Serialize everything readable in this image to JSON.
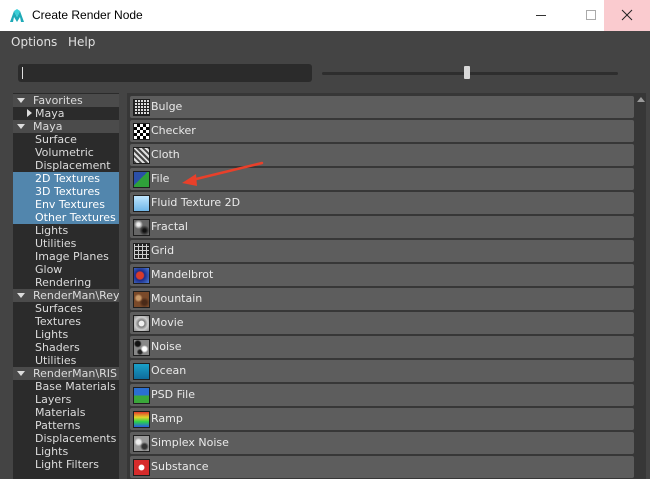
{
  "window": {
    "title": "Create Render Node",
    "icon": "maya-icon",
    "controls": [
      "minimize-icon",
      "maximize-icon",
      "close-icon"
    ]
  },
  "menu": {
    "items": [
      "Options",
      "Help"
    ]
  },
  "search": {
    "value": "",
    "placeholder": ""
  },
  "icon_size_slider": {
    "value_fraction": 0.49
  },
  "tree": [
    {
      "label": "Favorites",
      "type": "header",
      "expanded": true
    },
    {
      "label": "Maya",
      "type": "subheader",
      "expanded": false
    },
    {
      "label": "Maya",
      "type": "header",
      "expanded": true
    },
    {
      "label": "Surface",
      "type": "item"
    },
    {
      "label": "Volumetric",
      "type": "item"
    },
    {
      "label": "Displacement",
      "type": "item"
    },
    {
      "label": "2D Textures",
      "type": "item",
      "selected": true
    },
    {
      "label": "3D Textures",
      "type": "item",
      "selected": true
    },
    {
      "label": "Env Textures",
      "type": "item",
      "selected": true
    },
    {
      "label": "Other Textures",
      "type": "item",
      "selected": true
    },
    {
      "label": "Lights",
      "type": "item"
    },
    {
      "label": "Utilities",
      "type": "item"
    },
    {
      "label": "Image Planes",
      "type": "item"
    },
    {
      "label": "Glow",
      "type": "item"
    },
    {
      "label": "Rendering",
      "type": "item"
    },
    {
      "label": "RenderMan\\Reyes",
      "type": "header",
      "expanded": true
    },
    {
      "label": "Surfaces",
      "type": "item"
    },
    {
      "label": "Textures",
      "type": "item"
    },
    {
      "label": "Lights",
      "type": "item"
    },
    {
      "label": "Shaders",
      "type": "item"
    },
    {
      "label": "Utilities",
      "type": "item"
    },
    {
      "label": "RenderMan\\RIS",
      "type": "header",
      "expanded": true
    },
    {
      "label": "Base Materials",
      "type": "item"
    },
    {
      "label": "Layers",
      "type": "item"
    },
    {
      "label": "Materials",
      "type": "item"
    },
    {
      "label": "Patterns",
      "type": "item"
    },
    {
      "label": "Displacements",
      "type": "item"
    },
    {
      "label": "Lights",
      "type": "item"
    },
    {
      "label": "Light Filters",
      "type": "item"
    }
  ],
  "nodes": [
    {
      "label": "Bulge",
      "icon": "bulge-texture-icon"
    },
    {
      "label": "Checker",
      "icon": "checker-texture-icon"
    },
    {
      "label": "Cloth",
      "icon": "cloth-texture-icon"
    },
    {
      "label": "File",
      "icon": "file-texture-icon",
      "highlighted": true
    },
    {
      "label": "Fluid Texture 2D",
      "icon": "fluid-texture-icon"
    },
    {
      "label": "Fractal",
      "icon": "fractal-texture-icon"
    },
    {
      "label": "Grid",
      "icon": "grid-texture-icon"
    },
    {
      "label": "Mandelbrot",
      "icon": "mandelbrot-texture-icon"
    },
    {
      "label": "Mountain",
      "icon": "mountain-texture-icon"
    },
    {
      "label": "Movie",
      "icon": "movie-texture-icon"
    },
    {
      "label": "Noise",
      "icon": "noise-texture-icon"
    },
    {
      "label": "Ocean",
      "icon": "ocean-texture-icon"
    },
    {
      "label": "PSD File",
      "icon": "psd-file-texture-icon"
    },
    {
      "label": "Ramp",
      "icon": "ramp-texture-icon"
    },
    {
      "label": "Simplex Noise",
      "icon": "simplex-noise-texture-icon"
    },
    {
      "label": "Substance",
      "icon": "substance-texture-icon"
    }
  ],
  "annotation": {
    "arrow_color": "#e8402a",
    "points_to": "File"
  },
  "colors": {
    "selection": "#5286ad",
    "panel": "#444444",
    "list_row": "#5d5d5d"
  }
}
